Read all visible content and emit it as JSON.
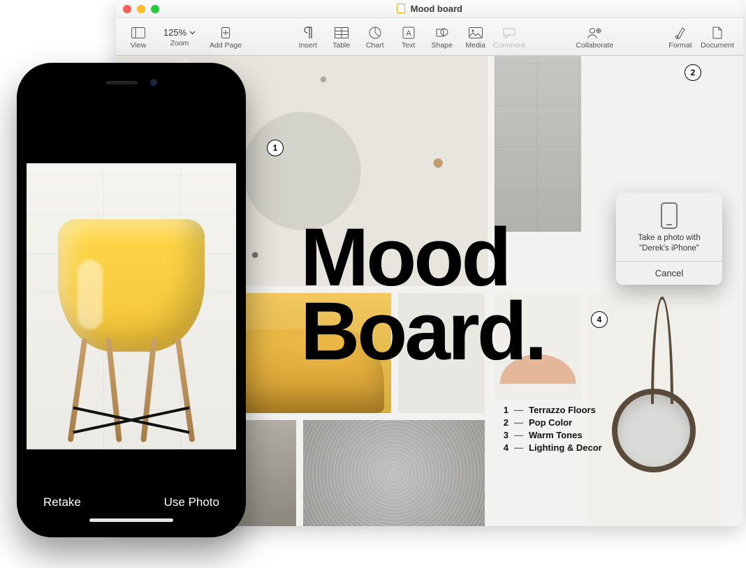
{
  "window_title": "Mood board",
  "zoom": "125%",
  "toolbar": {
    "view": "View",
    "zoom": "Zoom",
    "addpage": "Add Page",
    "insert": "Insert",
    "table": "Table",
    "chart": "Chart",
    "text": "Text",
    "shape": "Shape",
    "media": "Media",
    "comment": "Comment",
    "collaborate": "Collaborate",
    "format": "Format",
    "document": "Document"
  },
  "document": {
    "title_line1": "Mood",
    "title_line2": "Board.",
    "legend": [
      {
        "num": "1",
        "label": "Terrazzo Floors"
      },
      {
        "num": "2",
        "label": "Pop Color"
      },
      {
        "num": "3",
        "label": "Warm Tones"
      },
      {
        "num": "4",
        "label": "Lighting & Decor"
      }
    ],
    "callouts": {
      "topleft": "1",
      "topright": "2",
      "lamp": "4"
    }
  },
  "popover": {
    "line1": "Take a photo with",
    "line2": "\"Derek's iPhone\"",
    "cancel": "Cancel"
  },
  "iphone": {
    "retake": "Retake",
    "use_photo": "Use Photo"
  }
}
